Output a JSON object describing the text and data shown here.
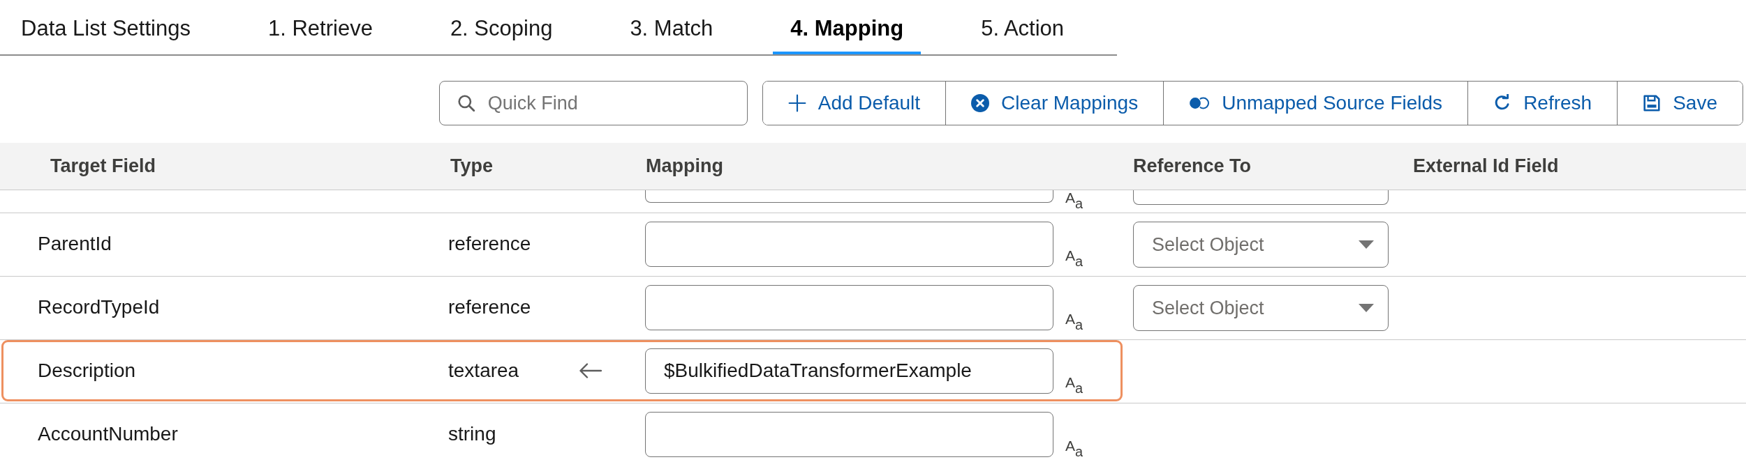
{
  "tabs": [
    {
      "label": "Data List Settings",
      "selected": false
    },
    {
      "label": "1. Retrieve",
      "selected": false
    },
    {
      "label": "2. Scoping",
      "selected": false
    },
    {
      "label": "3. Match",
      "selected": false
    },
    {
      "label": "4. Mapping",
      "selected": true
    },
    {
      "label": "5. Action",
      "selected": false
    }
  ],
  "toolbar": {
    "search": {
      "placeholder": "Quick Find"
    },
    "buttons": [
      {
        "kind": "add",
        "label": "Add Default"
      },
      {
        "kind": "clear",
        "label": "Clear Mappings"
      },
      {
        "kind": "unmapped",
        "label": "Unmapped Source Fields"
      },
      {
        "kind": "refresh",
        "label": "Refresh"
      },
      {
        "kind": "save",
        "label": "Save"
      }
    ]
  },
  "table": {
    "columns": [
      "Target Field",
      "Type",
      "Mapping",
      "Reference To",
      "External Id Field"
    ],
    "partial_row": {
      "format_hint": "A$_{a}$"
    },
    "rows": [
      {
        "target_field": "ParentId",
        "type": "reference",
        "highlighted": false,
        "mapped": false,
        "format_hint": "A$_{a}$",
        "reference_to": {
          "placeholder": "Select Object"
        }
      },
      {
        "target_field": "RecordTypeId",
        "type": "reference",
        "highlighted": false,
        "mapped": false,
        "format_hint": "A$_{a}$",
        "reference_to": {
          "placeholder": "Select Object"
        }
      },
      {
        "target_field": "Description",
        "type": "textarea",
        "highlighted": true,
        "mapped": true,
        "mapping_value": "$BulkifiedDataTransformerExample",
        "format_hint": "A$_{a}$"
      },
      {
        "target_field": "AccountNumber",
        "type": "string",
        "highlighted": false,
        "mapped": false,
        "format_hint": "A$_{a}$"
      }
    ]
  }
}
